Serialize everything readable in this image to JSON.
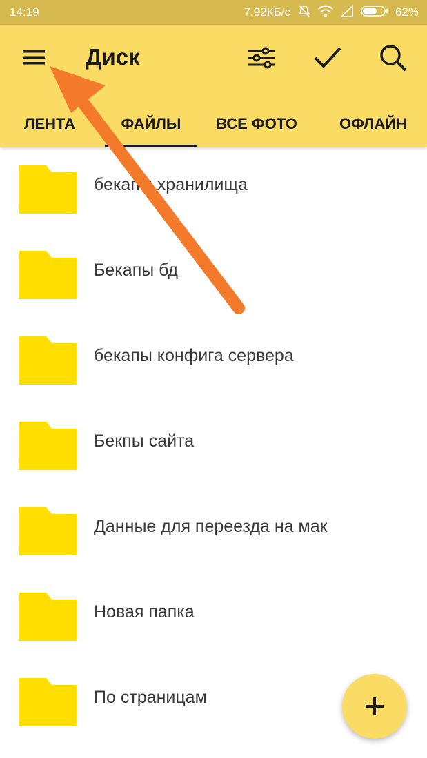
{
  "status_bar": {
    "time": "14:19",
    "speed": "7,92КБ/с",
    "battery": "62%"
  },
  "header": {
    "title": "Диск"
  },
  "tabs": [
    {
      "label": "ЛЕНТА"
    },
    {
      "label": "ФАЙЛЫ",
      "active": true
    },
    {
      "label": "ВСЕ ФОТО"
    },
    {
      "label": "ОФЛАЙН"
    }
  ],
  "folders": [
    {
      "name": "бекапы хранилища"
    },
    {
      "name": "Бекапы бд"
    },
    {
      "name": "бекапы конфига сервера"
    },
    {
      "name": "Бекпы сайта"
    },
    {
      "name": "Данные для переезда на мак"
    },
    {
      "name": "Новая папка"
    },
    {
      "name": "По страницам"
    }
  ],
  "colors": {
    "accent": "#fadc65",
    "status_bar": "#d6b94f",
    "folder": "#ffde00",
    "annotation_arrow": "#f47a2b"
  },
  "icons": {
    "menu": "hamburger-icon",
    "filter": "sliders-icon",
    "select": "check-icon",
    "search": "search-icon",
    "add": "plus-icon"
  }
}
